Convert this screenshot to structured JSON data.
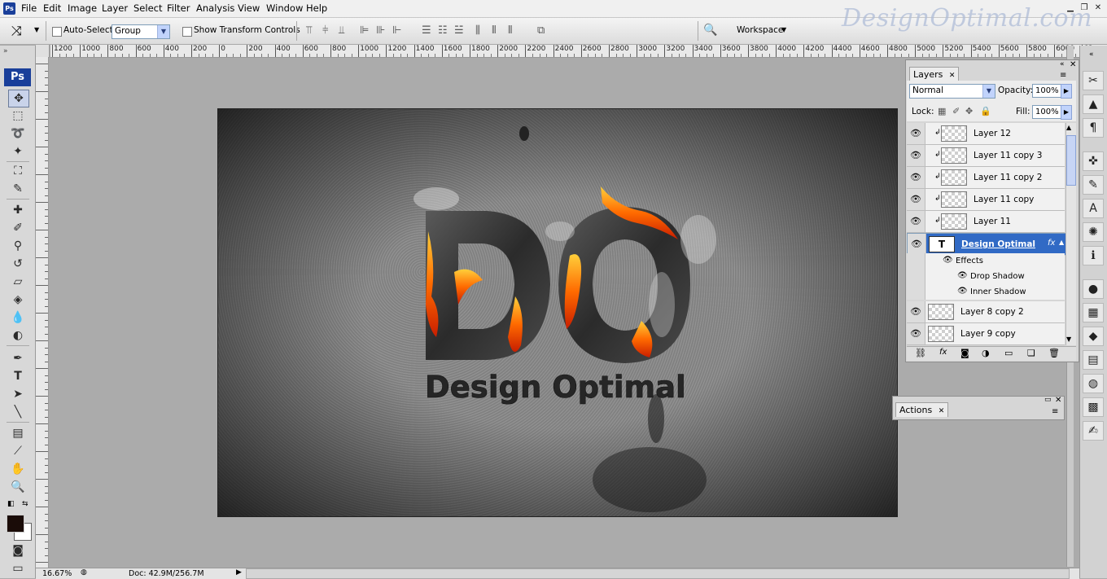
{
  "app": {
    "logo": "Ps",
    "watermark": "DesignOptimal.com"
  },
  "menu": [
    "File",
    "Edit",
    "Image",
    "Layer",
    "Select",
    "Filter",
    "Analysis",
    "View",
    "Window",
    "Help"
  ],
  "options": {
    "auto_select_label": "Auto-Select:",
    "auto_select_value": "Group",
    "show_transform_label": "Show Transform Controls",
    "workspace_label": "Workspace"
  },
  "ruler": {
    "h_labels": [
      "1200",
      "1000",
      "800",
      "600",
      "400",
      "200",
      "0",
      "200",
      "400",
      "600",
      "800",
      "1000",
      "1200",
      "1400",
      "1600",
      "1800",
      "2000",
      "2200",
      "2400",
      "2600",
      "2800",
      "3000",
      "3200",
      "3400",
      "3600",
      "3800",
      "4000",
      "4200",
      "4400",
      "4600",
      "4800",
      "5000",
      "5200",
      "5400",
      "5600",
      "5800",
      "6000",
      "62"
    ]
  },
  "canvas": {
    "title_big": "DO",
    "subtitle": "Design Optimal"
  },
  "layers_panel": {
    "tab": "Layers",
    "blend_mode": "Normal",
    "opacity_label": "Opacity:",
    "opacity_value": "100%",
    "lock_label": "Lock:",
    "fill_label": "Fill:",
    "fill_value": "100%",
    "layers": [
      {
        "name": "Layer 12"
      },
      {
        "name": "Layer 11 copy 3"
      },
      {
        "name": "Layer 11 copy 2"
      },
      {
        "name": "Layer 11 copy"
      },
      {
        "name": "Layer 11"
      },
      {
        "name": "Design Optimal"
      },
      {
        "name": "Effects"
      },
      {
        "name": "Drop Shadow"
      },
      {
        "name": "Inner Shadow"
      },
      {
        "name": "Layer 8 copy 2"
      },
      {
        "name": "Layer 9 copy"
      }
    ],
    "text_layer_badge": "T",
    "fx_badge": "fx"
  },
  "actions_panel": {
    "tab": "Actions"
  },
  "status": {
    "zoom": "16.67%",
    "doc": "Doc: 42.9M/256.7M"
  }
}
